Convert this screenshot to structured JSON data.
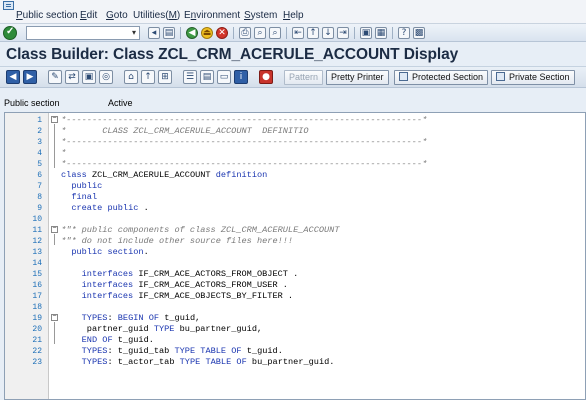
{
  "menu": [
    {
      "pre": "",
      "u": "P",
      "post": "ublic section"
    },
    {
      "pre": "",
      "u": "E",
      "post": "dit"
    },
    {
      "pre": "",
      "u": "G",
      "post": "oto"
    },
    {
      "pre": "Utilities(",
      "u": "M",
      "post": ")"
    },
    {
      "pre": "E",
      "u": "n",
      "post": "vironment"
    },
    {
      "pre": "",
      "u": "S",
      "post": "ystem"
    },
    {
      "pre": "",
      "u": "H",
      "post": "elp"
    }
  ],
  "command_field": {
    "value": ""
  },
  "title": "Class Builder: Class ZCL_CRM_ACERULE_ACCOUNT Display",
  "app_buttons": {
    "pattern": "Pattern",
    "pretty_printer": "Pretty Printer",
    "protected_section": "Protected Section",
    "private_section": "Private Section"
  },
  "status": {
    "section": "Public section",
    "state": "Active"
  },
  "code_lines": [
    {
      "n": "1",
      "t": "*---------------------------------------------------------------------*",
      "k": "cmt"
    },
    {
      "n": "2",
      "t": "*       CLASS ZCL_CRM_ACERULE_ACCOUNT  DEFINITIO",
      "k": "cmt"
    },
    {
      "n": "3",
      "t": "*---------------------------------------------------------------------*",
      "k": "cmt"
    },
    {
      "n": "4",
      "t": "*",
      "k": "cmt"
    },
    {
      "n": "5",
      "t": "*---------------------------------------------------------------------*",
      "k": "cmt"
    },
    {
      "n": "6",
      "t": "class ZCL_CRM_ACERULE_ACCOUNT definition",
      "k": "code"
    },
    {
      "n": "7",
      "t": "  public",
      "k": "code"
    },
    {
      "n": "8",
      "t": "  final",
      "k": "code"
    },
    {
      "n": "9",
      "t": "  create public .",
      "k": "code"
    },
    {
      "n": "10",
      "t": "",
      "k": "code"
    },
    {
      "n": "11",
      "t": "*\"* public components of class ZCL_CRM_ACERULE_ACCOUNT",
      "k": "cmt"
    },
    {
      "n": "12",
      "t": "*\"* do not include other source files here!!!",
      "k": "cmt"
    },
    {
      "n": "13",
      "t": "  public section.",
      "k": "code"
    },
    {
      "n": "14",
      "t": "",
      "k": "code"
    },
    {
      "n": "15",
      "t": "    interfaces IF_CRM_ACE_ACTORS_FROM_OBJECT .",
      "k": "code"
    },
    {
      "n": "16",
      "t": "    interfaces IF_CRM_ACE_ACTORS_FROM_USER .",
      "k": "code"
    },
    {
      "n": "17",
      "t": "    interfaces IF_CRM_ACE_OBJECTS_BY_FILTER .",
      "k": "code"
    },
    {
      "n": "18",
      "t": "",
      "k": "code"
    },
    {
      "n": "19",
      "t": "    TYPES: BEGIN OF t_guid,",
      "k": "code"
    },
    {
      "n": "20",
      "t": "     partner_guid TYPE bu_partner_guid,",
      "k": "code"
    },
    {
      "n": "21",
      "t": "    END OF t_guid.",
      "k": "code"
    },
    {
      "n": "22",
      "t": "    TYPES: t_guid_tab TYPE TABLE OF t_guid.",
      "k": "code"
    },
    {
      "n": "23",
      "t": "    TYPES: t_actor_tab TYPE TABLE OF bu_partner_guid.",
      "k": "code"
    }
  ]
}
